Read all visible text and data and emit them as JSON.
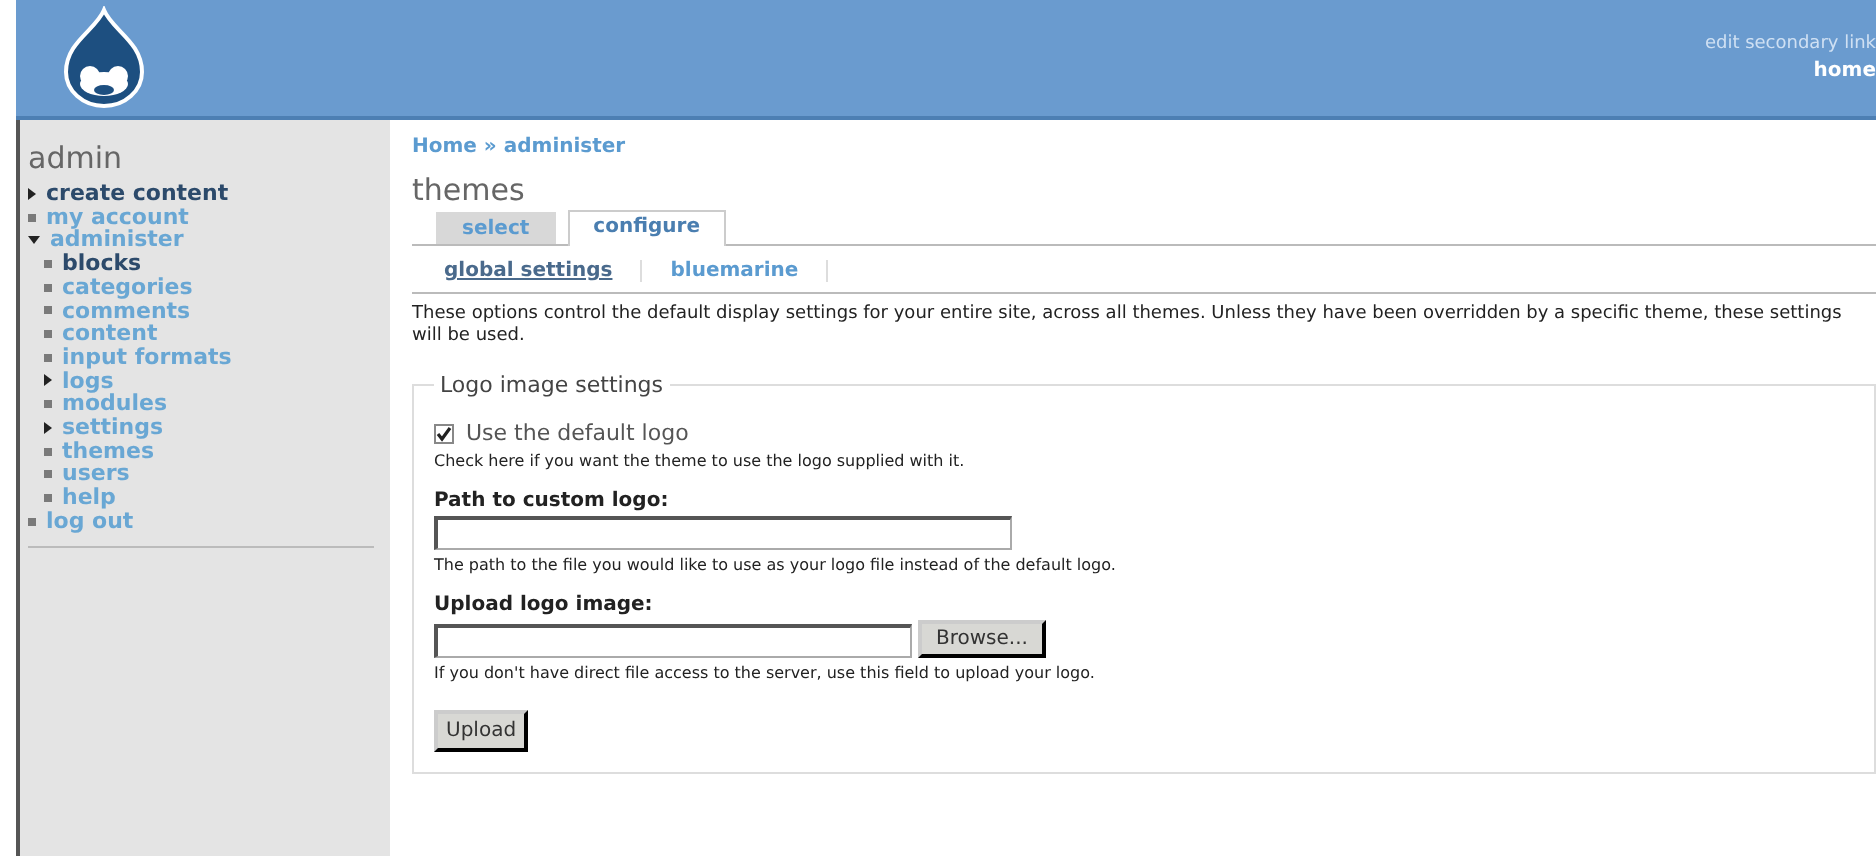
{
  "header": {
    "secondary_link": "edit secondary link",
    "primary_link": "home"
  },
  "sidebar": {
    "title": "admin",
    "items": [
      {
        "label": "create content",
        "kind": "collapsed",
        "active": true
      },
      {
        "label": "my account",
        "kind": "leaf",
        "active": false
      },
      {
        "label": "administer",
        "kind": "expanded",
        "active": false,
        "children": [
          {
            "label": "blocks",
            "kind": "leaf",
            "active": true
          },
          {
            "label": "categories",
            "kind": "leaf",
            "active": false
          },
          {
            "label": "comments",
            "kind": "leaf",
            "active": false
          },
          {
            "label": "content",
            "kind": "leaf",
            "active": false
          },
          {
            "label": "input formats",
            "kind": "leaf",
            "active": false
          },
          {
            "label": "logs",
            "kind": "collapsed",
            "active": false
          },
          {
            "label": "modules",
            "kind": "leaf",
            "active": false
          },
          {
            "label": "settings",
            "kind": "collapsed",
            "active": false
          },
          {
            "label": "themes",
            "kind": "leaf",
            "active": false
          },
          {
            "label": "users",
            "kind": "leaf",
            "active": false
          },
          {
            "label": "help",
            "kind": "leaf",
            "active": false
          }
        ]
      },
      {
        "label": "log out",
        "kind": "leaf",
        "active": false
      }
    ]
  },
  "breadcrumb": "Home » administer",
  "page_title": "themes",
  "tabs": [
    {
      "label": "select",
      "selected": false
    },
    {
      "label": "configure",
      "selected": true
    }
  ],
  "subtabs": [
    {
      "label": "global settings",
      "selected": true
    },
    {
      "label": "bluemarine",
      "selected": false
    }
  ],
  "intro": "These options control the default display settings for your entire site, across all themes. Unless they have been overridden by a specific theme, these settings will be used.",
  "fieldset": {
    "legend": "Logo image settings",
    "checkbox": {
      "label": "Use the default logo",
      "checked": true,
      "help": "Check here if you want the theme to use the logo supplied with it."
    },
    "path_field": {
      "label": "Path to custom logo:",
      "help": "The path to the file you would like to use as your logo file instead of the default logo."
    },
    "upload_field": {
      "label": "Upload logo image:",
      "browse": "Browse...",
      "help": "If you don't have direct file access to the server, use this field to upload your logo."
    },
    "upload_button": "Upload"
  }
}
